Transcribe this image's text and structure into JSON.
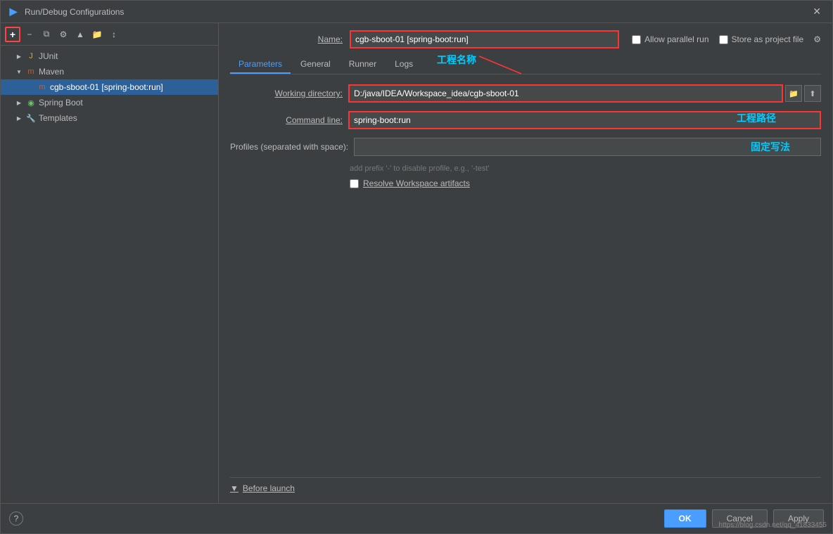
{
  "dialog": {
    "title": "Run/Debug Configurations",
    "close_label": "✕"
  },
  "toolbar": {
    "add_label": "+",
    "remove_label": "−",
    "copy_label": "⧉",
    "settings_label": "⚙",
    "up_label": "▲",
    "folder_label": "📁",
    "sort_label": "↕"
  },
  "tree": {
    "items": [
      {
        "id": "junit",
        "label": "JUnit",
        "indent": 1,
        "arrow": "▶",
        "icon": "J",
        "icon_class": "junit-icon"
      },
      {
        "id": "maven",
        "label": "Maven",
        "indent": 1,
        "arrow": "▼",
        "icon": "m",
        "icon_class": "maven-icon"
      },
      {
        "id": "cgb",
        "label": "cgb-sboot-01 [spring-boot:run]",
        "indent": 2,
        "arrow": "",
        "icon": "m",
        "icon_class": "maven-icon",
        "selected": true
      },
      {
        "id": "springboot",
        "label": "Spring Boot",
        "indent": 1,
        "arrow": "▶",
        "icon": "◉",
        "icon_class": "spring-icon"
      },
      {
        "id": "templates",
        "label": "Templates",
        "indent": 1,
        "arrow": "▶",
        "icon": "🔧",
        "icon_class": "folder-icon"
      }
    ]
  },
  "header": {
    "name_label": "Name:",
    "name_value": "cgb-sboot-01 [spring-boot:run]",
    "allow_parallel_label": "Allow parallel run",
    "store_label": "Store as project file",
    "annotation_name": "工程名称"
  },
  "tabs": [
    {
      "id": "parameters",
      "label": "Parameters",
      "active": true
    },
    {
      "id": "general",
      "label": "General",
      "active": false
    },
    {
      "id": "runner",
      "label": "Runner",
      "active": false
    },
    {
      "id": "logs",
      "label": "Logs",
      "active": false
    }
  ],
  "form": {
    "working_directory_label": "Working directory:",
    "working_directory_value": "D:/java/IDEA/Workspace_idea/cgb-sboot-01",
    "command_line_label": "Command line:",
    "command_line_value": "spring-boot:run",
    "profiles_label": "Profiles (separated with space):",
    "profiles_value": "",
    "profiles_hint": "add prefix '-' to disable profile, e.g., '-test'",
    "resolve_workspace_label": "Resolve Workspace artifacts",
    "annotation_path": "工程路径",
    "annotation_fixed": "固定写法"
  },
  "before_launch": {
    "label": "Before launch"
  },
  "footer": {
    "help_label": "?",
    "ok_label": "OK",
    "cancel_label": "Cancel",
    "apply_label": "Apply"
  },
  "watermark": "https://blog.csdn.net/qq_41833455"
}
